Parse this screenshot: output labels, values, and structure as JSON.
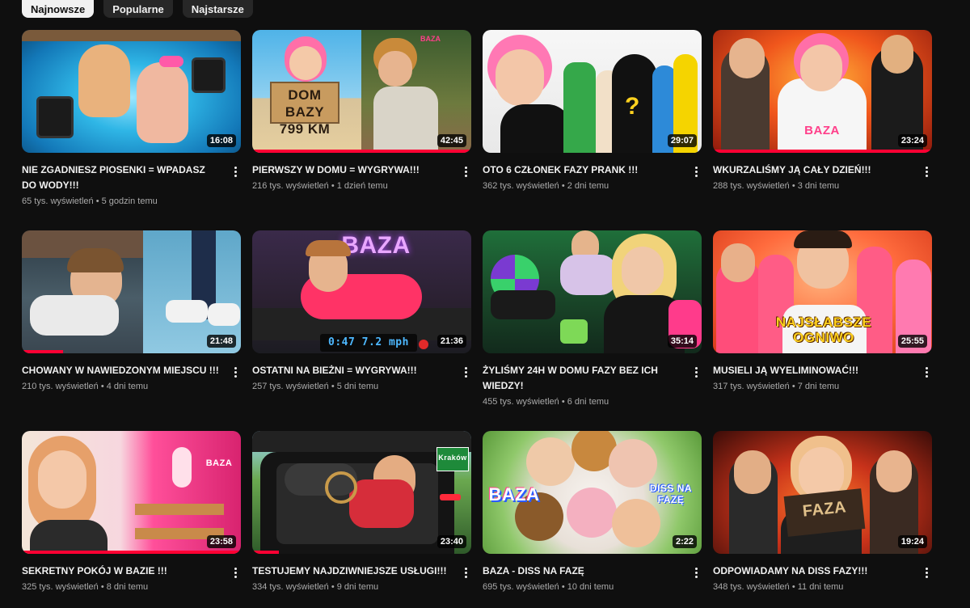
{
  "filters": [
    {
      "label": "Najnowsze",
      "active": true
    },
    {
      "label": "Popularne",
      "active": false
    },
    {
      "label": "Najstarsze",
      "active": false
    }
  ],
  "videos": [
    {
      "title": "NIE ZGADNIESZ PIOSENKI = WPADASZ DO WODY!!!",
      "views": "65 tys. wyświetleń",
      "age": "5 godzin temu",
      "duration": "16:08",
      "progress": 0
    },
    {
      "title": "PIERWSZY W DOMU = WYGRYWA!!!",
      "views": "216 tys. wyświetleń",
      "age": "1 dzień temu",
      "duration": "42:45",
      "progress": 1,
      "overlay": "DOM BAZY 799 KM"
    },
    {
      "title": "OTO 6 CZŁONEK FAZY PRANK !!!",
      "views": "362 tys. wyświetleń",
      "age": "2 dni temu",
      "duration": "29:07",
      "progress": 0
    },
    {
      "title": "WKURZALIŚMY JĄ CAŁY DZIEŃ!!!",
      "views": "288 tys. wyświetleń",
      "age": "3 dni temu",
      "duration": "23:24",
      "progress": 1,
      "overlay": "BAZA"
    },
    {
      "title": "CHOWANY W NAWIEDZONYM MIEJSCU !!!",
      "views": "210 tys. wyświetleń",
      "age": "4 dni temu",
      "duration": "21:48",
      "progress": 0.19
    },
    {
      "title": "OSTATNI NA BIEŻNI = WYGRYWA!!!",
      "views": "257 tys. wyświetleń",
      "age": "5 dni temu",
      "duration": "21:36",
      "progress": 0,
      "overlay": "BAZA",
      "overlay2": "0:47 7.2 mph"
    },
    {
      "title": "ŻYLIŚMY 24H W DOMU FAZY BEZ ICH WIEDZY!",
      "views": "455 tys. wyświetleń",
      "age": "6 dni temu",
      "duration": "35:14",
      "progress": 0
    },
    {
      "title": "MUSIELI JĄ WYELIMINOWAĆ!!!",
      "views": "317 tys. wyświetleń",
      "age": "7 dni temu",
      "duration": "25:55",
      "progress": 0,
      "overlay": "NAJSŁABSZE OGNIWO"
    },
    {
      "title": "SEKRETNY POKÓJ W BAZIE !!!",
      "views": "325 tys. wyświetleń",
      "age": "8 dni temu",
      "duration": "23:58",
      "progress": 1,
      "overlay": "BAZA"
    },
    {
      "title": "TESTUJEMY NAJDZIWNIEJSZE USŁUGI!!!",
      "views": "334 tys. wyświetleń",
      "age": "9 dni temu",
      "duration": "23:40",
      "progress": 0.12,
      "overlay": "Kraków"
    },
    {
      "title": "BAZA - DISS NA FAZĘ",
      "views": "695 tys. wyświetleń",
      "age": "10 dni temu",
      "duration": "2:22",
      "progress": 0,
      "overlay": "BAZA",
      "overlay2": "DISS NA FAZĘ"
    },
    {
      "title": "ODPOWIADAMY NA DISS FAZY!!!",
      "views": "348 tys. wyświetleń",
      "age": "11 dni temu",
      "duration": "19:24",
      "progress": 0,
      "overlay": "FAZA"
    }
  ],
  "colors": {
    "background": "#0f0f0f",
    "chip": "#272727",
    "chip_active": "#f1f1f1",
    "progress": "#ff0033",
    "meta_text": "#aaaaaa"
  },
  "icons": {
    "menu": "more-vert-icon"
  }
}
